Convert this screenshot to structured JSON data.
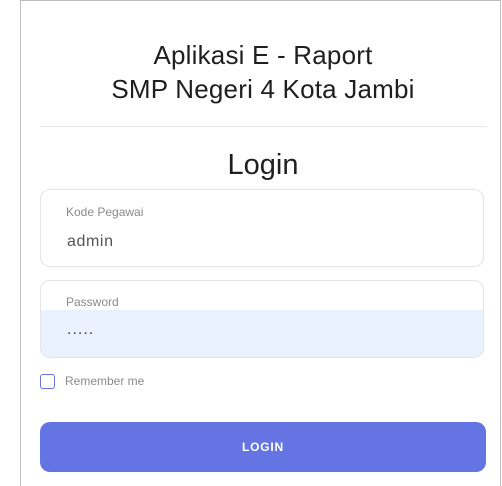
{
  "header": {
    "title_line1": "Aplikasi E - Raport",
    "title_line2": "SMP Negeri 4 Kota Jambi"
  },
  "form": {
    "heading": "Login",
    "username": {
      "label": "Kode Pegawai",
      "value": "admin"
    },
    "password": {
      "label": "Password",
      "masked_value": "....."
    },
    "remember": {
      "label": "Remember me",
      "checked": false
    },
    "submit_label": "LOGIN"
  },
  "colors": {
    "accent": "#6574e3",
    "autofill_bg": "#e9f0fe",
    "text_dark": "#1f1f1f",
    "text_muted": "#8a8a8a"
  }
}
